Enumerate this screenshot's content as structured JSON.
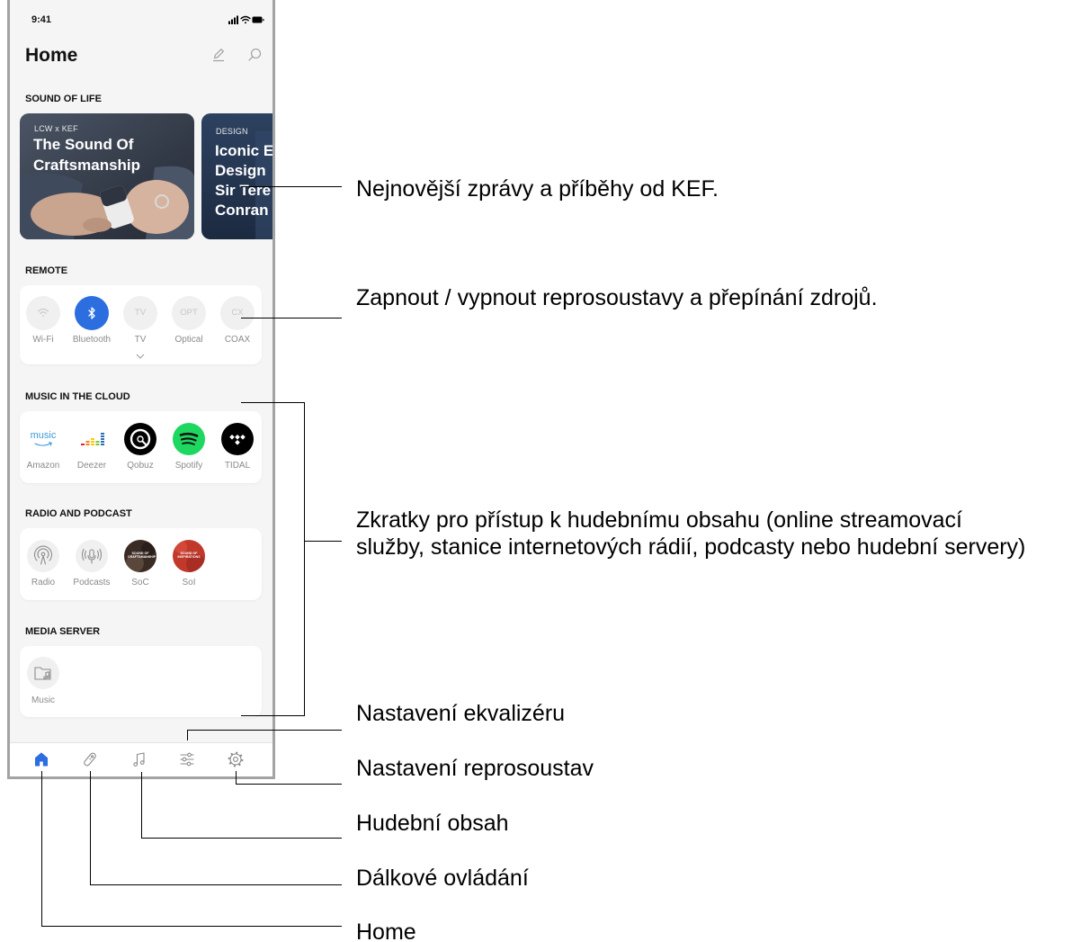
{
  "colors": {
    "accent": "#2c6de0",
    "spotify_green": "#1ed760",
    "screen_background": "#f5f5f5",
    "card_background": "#ffffff"
  },
  "status_bar": {
    "time": "9:41",
    "icons": [
      "signal-icon",
      "wifi-icon",
      "battery-icon"
    ]
  },
  "header": {
    "title": "Home",
    "actions": [
      {
        "icon": "pencil-icon"
      },
      {
        "icon": "search-icon"
      }
    ]
  },
  "sound_of_life": {
    "heading": "SOUND OF LIFE",
    "cards": [
      {
        "tag": "LCW x KEF",
        "title_lines": [
          "The Sound Of",
          "Craftsmanship"
        ]
      },
      {
        "tag": "DESIGN",
        "title_lines": [
          "Iconic E",
          "Design",
          "Sir Tere",
          "Conran"
        ]
      }
    ]
  },
  "remote": {
    "heading": "REMOTE",
    "sources": [
      {
        "label": "Wi-Fi",
        "icon": "wifi-icon",
        "active": false
      },
      {
        "label": "Bluetooth",
        "icon": "bluetooth-icon",
        "active": true
      },
      {
        "label": "TV",
        "glyph": "TV",
        "active": false,
        "expandable": true
      },
      {
        "label": "Optical",
        "glyph": "OPT",
        "active": false
      },
      {
        "label": "COAX",
        "glyph": "CX",
        "active": false
      }
    ]
  },
  "music_cloud": {
    "heading": "MUSIC IN THE CLOUD",
    "services": [
      {
        "label": "Amazon",
        "logo_text": "music",
        "icon": "amazon-music-logo"
      },
      {
        "label": "Deezer",
        "icon": "deezer-logo"
      },
      {
        "label": "Qobuz",
        "icon": "qobuz-logo"
      },
      {
        "label": "Spotify",
        "icon": "spotify-logo"
      },
      {
        "label": "TIDAL",
        "icon": "tidal-logo"
      }
    ]
  },
  "radio_podcast": {
    "heading": "RADIO AND PODCAST",
    "items": [
      {
        "label": "Radio",
        "icon": "radio-icon"
      },
      {
        "label": "Podcasts",
        "icon": "podcast-icon"
      },
      {
        "label": "SoC",
        "artwork_text": "SOUND OF CRAFTSMANSHIP"
      },
      {
        "label": "SoI",
        "artwork_text": "SOUND OF INSPIRATIONS"
      }
    ]
  },
  "media_server": {
    "heading": "MEDIA SERVER",
    "items": [
      {
        "label": "Music",
        "icon": "music-folder-icon"
      }
    ]
  },
  "tab_bar": {
    "tabs": [
      {
        "icon": "home-icon",
        "active": true
      },
      {
        "icon": "remote-icon",
        "active": false
      },
      {
        "icon": "music-note-icon",
        "active": false
      },
      {
        "icon": "equalizer-icon",
        "active": false
      },
      {
        "icon": "settings-icon",
        "active": false
      }
    ]
  },
  "callouts": {
    "news": "Nejnovější zprávy a příběhy od KEF.",
    "remote": "Zapnout / vypnout reprosoustavy a přepínání zdrojů.",
    "shortcuts_lines": [
      "Zkratky pro přístup k hudebnímu obsahu (online streamovací",
      "služby, stanice internetových rádií, podcasty nebo hudební servery)"
    ],
    "equalizer": "Nastavení ekvalizéru",
    "speaker_settings": "Nastavení reprosoustav",
    "music_content": "Hudební obsah",
    "remote_control": "Dálkové ovládání",
    "home": "Home"
  }
}
